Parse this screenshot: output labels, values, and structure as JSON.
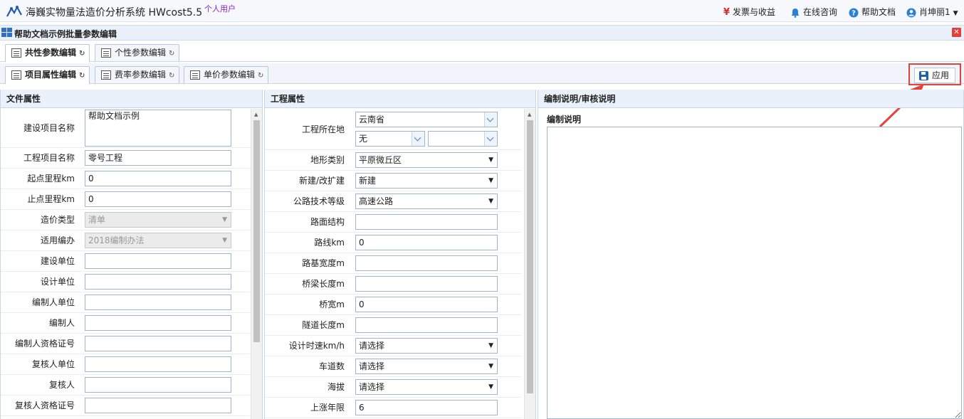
{
  "header": {
    "app_title": "海巍实物量法造价分析系统 HWcost5.5",
    "user_type": "个人用户",
    "links": [
      {
        "label": "发票与收益",
        "icon": "yen-icon"
      },
      {
        "label": "在线咨询",
        "icon": "chat-bell-icon"
      },
      {
        "label": "帮助文档",
        "icon": "help-icon"
      },
      {
        "label": "肖坤丽1",
        "icon": "user-icon"
      }
    ]
  },
  "panel": {
    "title": "帮助文档示例批量参数编辑"
  },
  "tabs_row1": [
    {
      "label": "共性参数编辑",
      "active": true
    },
    {
      "label": "个性参数编辑",
      "active": false
    }
  ],
  "tabs_row2": [
    {
      "label": "项目属性编辑",
      "active": true
    },
    {
      "label": "费率参数编辑",
      "active": false
    },
    {
      "label": "单价参数编辑",
      "active": false
    }
  ],
  "apply_label": "应用",
  "file_props": {
    "title": "文件属性",
    "rows": [
      {
        "label": "建设项目名称",
        "value": "帮助文档示例"
      },
      {
        "label": "工程项目名称",
        "value": "零号工程"
      },
      {
        "label": "起点里程km",
        "value": "0"
      },
      {
        "label": "止点里程km",
        "value": "0"
      },
      {
        "label": "造价类型",
        "value": "清单"
      },
      {
        "label": "适用编办",
        "value": "2018编制办法"
      },
      {
        "label": "建设单位",
        "value": ""
      },
      {
        "label": "设计单位",
        "value": ""
      },
      {
        "label": "编制人单位",
        "value": ""
      },
      {
        "label": "编制人",
        "value": ""
      },
      {
        "label": "编制人资格证号",
        "value": ""
      },
      {
        "label": "复核人单位",
        "value": ""
      },
      {
        "label": "复核人",
        "value": ""
      },
      {
        "label": "复核人资格证号",
        "value": ""
      }
    ]
  },
  "project_props": {
    "title": "工程属性",
    "location": {
      "label": "工程所在地",
      "province": "云南省",
      "city": "无",
      "county": ""
    },
    "rows": [
      {
        "label": "地形类别",
        "value": "平原微丘区"
      },
      {
        "label": "新建/改扩建",
        "value": "新建"
      },
      {
        "label": "公路技术等级",
        "value": "高速公路"
      },
      {
        "label": "路面结构",
        "value": ""
      },
      {
        "label": "路线km",
        "value": "0"
      },
      {
        "label": "路基宽度m",
        "value": ""
      },
      {
        "label": "桥梁长度m",
        "value": ""
      },
      {
        "label": "桥宽m",
        "value": "0"
      },
      {
        "label": "隧道长度m",
        "value": ""
      },
      {
        "label": "设计时速km/h",
        "value": "请选择"
      },
      {
        "label": "车道数",
        "value": "请选择"
      },
      {
        "label": "海拔",
        "value": "请选择"
      },
      {
        "label": "上涨年限",
        "value": "6"
      }
    ]
  },
  "notes": {
    "title": "编制说明/审核说明",
    "label": "编制说明",
    "text": ""
  },
  "colors": {
    "accent": "#2f6fc6",
    "highlight_red": "#e0453b",
    "header_bg": "#eaf1fb"
  }
}
